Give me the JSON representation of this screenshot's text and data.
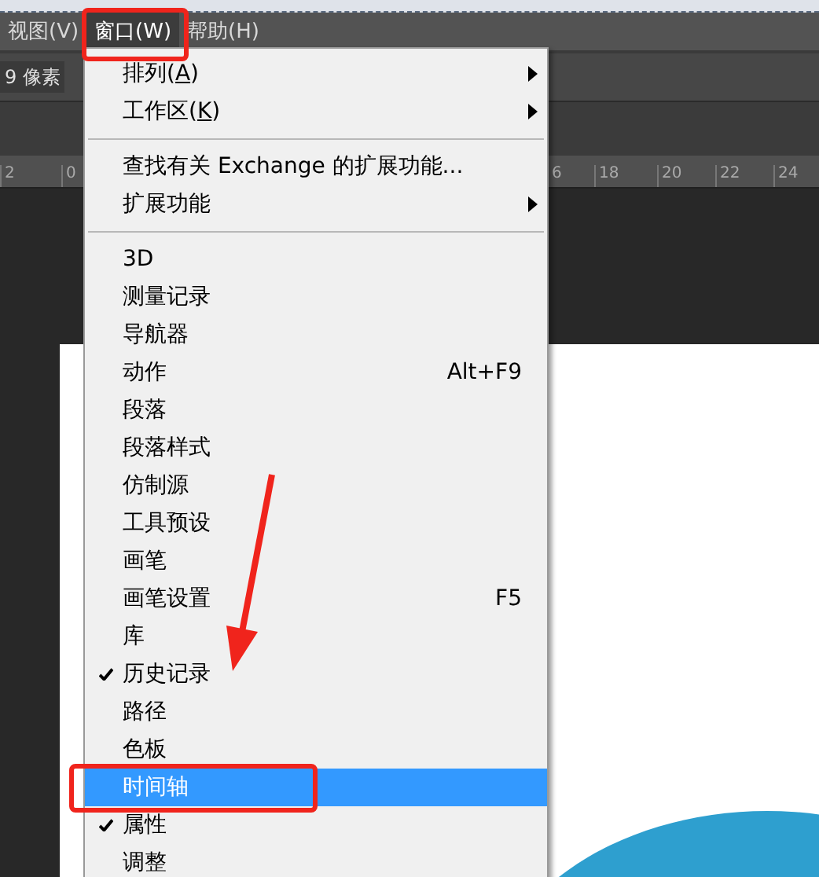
{
  "menubar": {
    "items": [
      {
        "label": "视图(V)",
        "selected": false
      },
      {
        "label": "窗口(W)",
        "selected": true
      },
      {
        "label": "帮助(H)",
        "selected": false
      }
    ]
  },
  "options_bar": {
    "field_value": "9 像素"
  },
  "ruler": {
    "ticks": [
      "2",
      "0",
      "6",
      "18",
      "20",
      "22",
      "24"
    ]
  },
  "menu": {
    "items": [
      {
        "kind": "item",
        "label": "排列(",
        "access_key": "A",
        "label_end": ")",
        "submenu": true,
        "checked": false,
        "selected": false
      },
      {
        "kind": "item",
        "label": "工作区(",
        "access_key": "K",
        "label_end": ")",
        "submenu": true,
        "checked": false,
        "selected": false
      },
      {
        "kind": "separator"
      },
      {
        "kind": "item",
        "label": "查找有关 Exchange 的扩展功能...",
        "submenu": false,
        "checked": false,
        "selected": false
      },
      {
        "kind": "item",
        "label": "扩展功能",
        "submenu": true,
        "checked": false,
        "selected": false
      },
      {
        "kind": "separator"
      },
      {
        "kind": "item",
        "label": "3D",
        "submenu": false,
        "checked": false,
        "selected": false
      },
      {
        "kind": "item",
        "label": "测量记录",
        "submenu": false,
        "checked": false,
        "selected": false
      },
      {
        "kind": "item",
        "label": "导航器",
        "submenu": false,
        "checked": false,
        "selected": false
      },
      {
        "kind": "item",
        "label": "动作",
        "shortcut": "Alt+F9",
        "submenu": false,
        "checked": false,
        "selected": false
      },
      {
        "kind": "item",
        "label": "段落",
        "submenu": false,
        "checked": false,
        "selected": false
      },
      {
        "kind": "item",
        "label": "段落样式",
        "submenu": false,
        "checked": false,
        "selected": false
      },
      {
        "kind": "item",
        "label": "仿制源",
        "submenu": false,
        "checked": false,
        "selected": false
      },
      {
        "kind": "item",
        "label": "工具预设",
        "submenu": false,
        "checked": false,
        "selected": false
      },
      {
        "kind": "item",
        "label": "画笔",
        "submenu": false,
        "checked": false,
        "selected": false
      },
      {
        "kind": "item",
        "label": "画笔设置",
        "shortcut": "F5",
        "submenu": false,
        "checked": false,
        "selected": false
      },
      {
        "kind": "item",
        "label": "库",
        "submenu": false,
        "checked": false,
        "selected": false
      },
      {
        "kind": "item",
        "label": "历史记录",
        "submenu": false,
        "checked": true,
        "selected": false
      },
      {
        "kind": "item",
        "label": "路径",
        "submenu": false,
        "checked": false,
        "selected": false
      },
      {
        "kind": "item",
        "label": "色板",
        "submenu": false,
        "checked": false,
        "selected": false
      },
      {
        "kind": "item",
        "label": "时间轴",
        "submenu": false,
        "checked": false,
        "selected": true
      },
      {
        "kind": "item",
        "label": "属性",
        "submenu": false,
        "checked": true,
        "selected": false
      },
      {
        "kind": "item",
        "label": "调整",
        "submenu": false,
        "checked": false,
        "selected": false
      }
    ]
  }
}
